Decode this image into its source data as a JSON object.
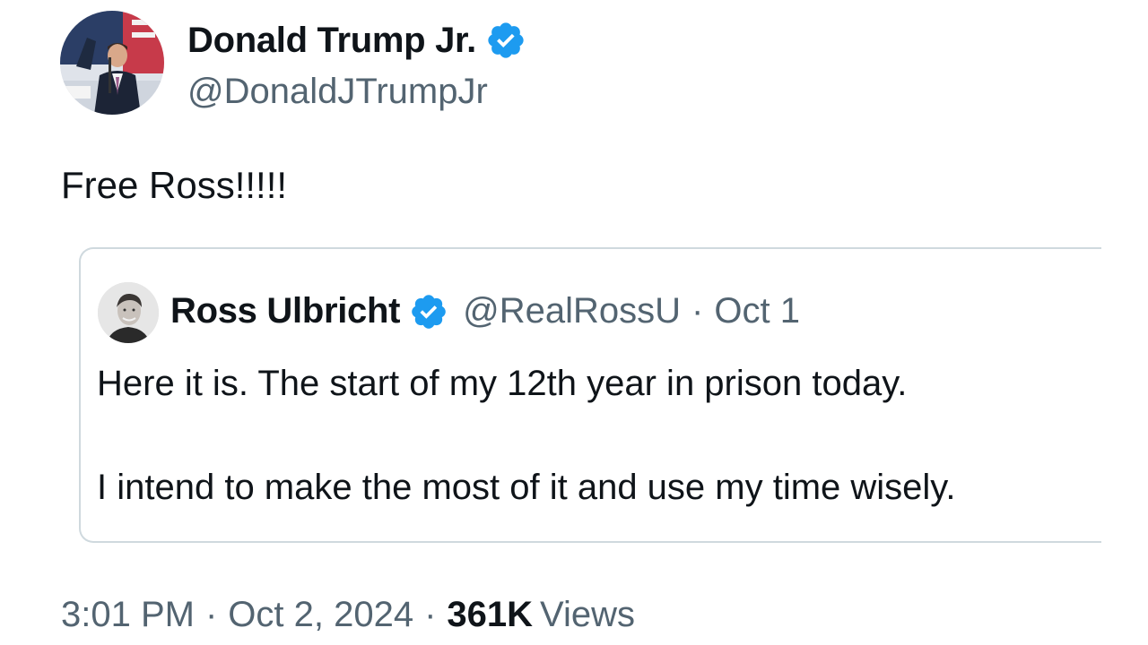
{
  "author": {
    "name": "Donald Trump Jr.",
    "handle": "@DonaldJTrumpJr",
    "avatar_icon": "profile-photo-man-at-podium",
    "verified_icon": "verified-badge-icon"
  },
  "tweet": {
    "text": "Free Ross!!!!!"
  },
  "quote": {
    "author_name": "Ross Ulbricht",
    "handle": "@RealRossU",
    "separator": "·",
    "date": "Oct 1",
    "avatar_icon": "profile-photo-man",
    "verified_icon": "verified-badge-icon",
    "line1": "Here it is. The start of my 12th year in prison today.",
    "line2": "I intend to make the most of it and use my time wisely."
  },
  "meta": {
    "time": "3:01 PM",
    "separator": "·",
    "date": "Oct 2, 2024",
    "views_count": "361K",
    "views_label": "Views"
  },
  "colors": {
    "text_primary": "#0f1419",
    "text_secondary": "#536471",
    "verified_blue": "#1d9bf0",
    "card_border": "#cfd9de"
  }
}
